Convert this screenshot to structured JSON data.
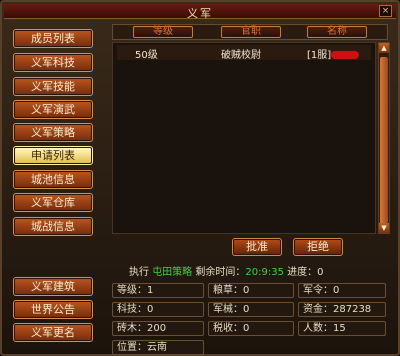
{
  "window": {
    "title": "义军",
    "close_label": "×"
  },
  "sidebar": {
    "items": [
      {
        "label": "成员列表",
        "active": false
      },
      {
        "label": "义军科技",
        "active": false
      },
      {
        "label": "义军技能",
        "active": false
      },
      {
        "label": "义军演武",
        "active": false
      },
      {
        "label": "义军策略",
        "active": false
      },
      {
        "label": "申请列表",
        "active": true
      },
      {
        "label": "城池信息",
        "active": false
      },
      {
        "label": "义军仓库",
        "active": false
      },
      {
        "label": "城战信息",
        "active": false
      }
    ],
    "bottom_items": [
      {
        "label": "义军建筑"
      },
      {
        "label": "世界公告"
      },
      {
        "label": "义军更名"
      }
    ]
  },
  "table": {
    "headers": [
      "等级",
      "官职",
      "名称"
    ],
    "rows": [
      {
        "level": "50级",
        "rank": "破贼校尉",
        "name_prefix": "[1服]"
      }
    ]
  },
  "actions": {
    "approve": "批准",
    "reject": "拒绝"
  },
  "execution": {
    "prefix": "执行",
    "policy": "屯田策略",
    "time_label": "剩余时间：",
    "time_value": "20:9:35",
    "progress_label": "进度：",
    "progress_value": "0"
  },
  "stats": {
    "level": "等级：1",
    "grain": "粮草：0",
    "military_order": "军令：0",
    "tech": "科技：0",
    "weapons": "军械：0",
    "funds": "资金：287238",
    "timber": "砖木：200",
    "tax": "税收：0",
    "people": "人数：15",
    "location": "位置：云南"
  },
  "colors": {
    "accent_green": "#40d040",
    "button_orange": "#b8541e",
    "redaction": "#d01010"
  }
}
